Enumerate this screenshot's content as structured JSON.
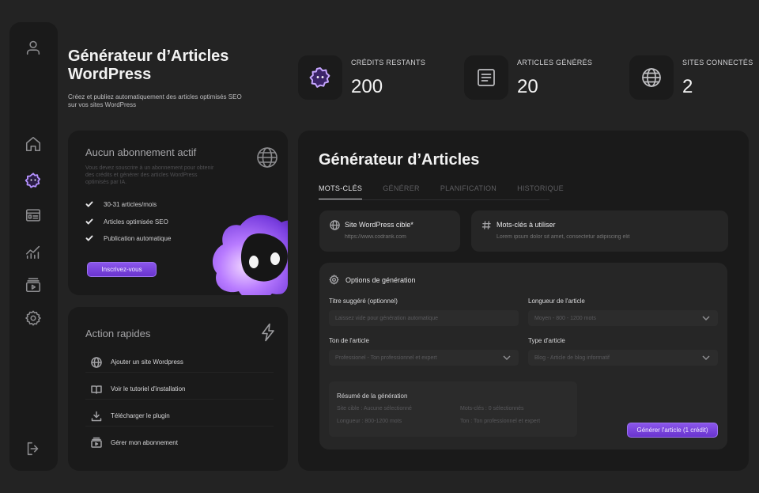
{
  "header": {
    "title": "Générateur d’Articles WordPress",
    "subtitle": "Créez et publiez automatiquement des articles optimisés SEO sur vos sites WordPress"
  },
  "stats": [
    {
      "label": "CRÉDITS RESTANTS",
      "value": "200",
      "icon": "sparkle-badge-icon"
    },
    {
      "label": "ARTICLES GÉNÉRÉS",
      "value": "20",
      "icon": "article-icon"
    },
    {
      "label": "SITES CONNECTÉS",
      "value": "2",
      "icon": "globe-icon"
    }
  ],
  "sidebar": {
    "items": [
      "user-icon",
      "home-icon",
      "ai-generator-icon",
      "layout-icon",
      "analytics-icon",
      "media-icon",
      "settings-icon",
      "logout-icon"
    ],
    "active": "ai-generator-icon"
  },
  "subscription": {
    "title": "Aucun abonnement actif",
    "description": "Vous devez souscrire à un abonnement pour obtenir des crédits et générer des articles WordPress optimisés par IA.",
    "features": [
      "30-31 articles/mois",
      "Articles optimisée SEO",
      "Publication automatique"
    ],
    "button_label": "Inscrivez-vous"
  },
  "quick_actions": {
    "title": "Action rapides",
    "items": [
      {
        "label": "Ajouter un site Wordpress",
        "icon": "globe-icon"
      },
      {
        "label": "Voir le tutoriel d'installation",
        "icon": "book-icon"
      },
      {
        "label": "Télécharger le plugin",
        "icon": "download-icon"
      },
      {
        "label": "Gérer mon abonnement",
        "icon": "subscription-icon"
      }
    ]
  },
  "generator": {
    "title": "Générateur d’Articles",
    "tabs": [
      "MOTS-CLÉS",
      "GÉNÉRER",
      "PLANIFICATION",
      "HISTORIQUE"
    ],
    "active_tab": "MOTS-CLÉS",
    "site_field": {
      "label": "Site WordPress cible*",
      "placeholder": "https://www.codrank.com"
    },
    "keywords_field": {
      "label": "Mots-clés à utiliser",
      "placeholder": "Lorem ipsum dolor sit amet, consectetur adipiscing elit"
    },
    "options": {
      "title": "Options de génération",
      "title_suggested": {
        "label": "Titre suggéré (optionnel)",
        "placeholder": "Laissez vide pour génération automatique"
      },
      "length": {
        "label": "Longueur de l'article",
        "value": "Moyen - 800 - 1200 mots"
      },
      "tone": {
        "label": "Ton de l'article",
        "value": "Professionel - Ton professionnel et expert"
      },
      "type": {
        "label": "Type d'article",
        "value": "Blog - Article de blog informatif"
      }
    },
    "summary": {
      "title": "Résumé de la génération",
      "site": "Site cible : Aucune sélectionné",
      "keywords": "Mots-clés : 0 sélectionnés",
      "length": "Longueur : 800-1200 mots",
      "tone": "Ton : Ton professionnel et expert"
    },
    "generate_button": "Générer l'article (1 crédit)"
  },
  "colors": {
    "accent": "#7a45df",
    "background": "#232323",
    "card": "#1a1a1a"
  }
}
